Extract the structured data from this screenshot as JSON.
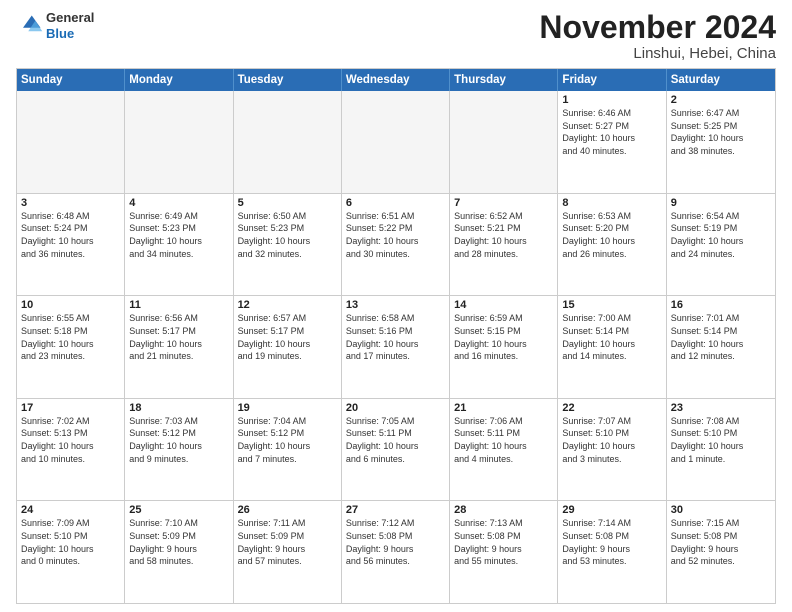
{
  "header": {
    "logo": {
      "line1": "General",
      "line2": "Blue"
    },
    "title": "November 2024",
    "location": "Linshui, Hebei, China"
  },
  "weekdays": [
    "Sunday",
    "Monday",
    "Tuesday",
    "Wednesday",
    "Thursday",
    "Friday",
    "Saturday"
  ],
  "rows": [
    [
      {
        "day": "",
        "info": "",
        "empty": true
      },
      {
        "day": "",
        "info": "",
        "empty": true
      },
      {
        "day": "",
        "info": "",
        "empty": true
      },
      {
        "day": "",
        "info": "",
        "empty": true
      },
      {
        "day": "",
        "info": "",
        "empty": true
      },
      {
        "day": "1",
        "info": "Sunrise: 6:46 AM\nSunset: 5:27 PM\nDaylight: 10 hours\nand 40 minutes.",
        "empty": false
      },
      {
        "day": "2",
        "info": "Sunrise: 6:47 AM\nSunset: 5:25 PM\nDaylight: 10 hours\nand 38 minutes.",
        "empty": false
      }
    ],
    [
      {
        "day": "3",
        "info": "Sunrise: 6:48 AM\nSunset: 5:24 PM\nDaylight: 10 hours\nand 36 minutes.",
        "empty": false
      },
      {
        "day": "4",
        "info": "Sunrise: 6:49 AM\nSunset: 5:23 PM\nDaylight: 10 hours\nand 34 minutes.",
        "empty": false
      },
      {
        "day": "5",
        "info": "Sunrise: 6:50 AM\nSunset: 5:23 PM\nDaylight: 10 hours\nand 32 minutes.",
        "empty": false
      },
      {
        "day": "6",
        "info": "Sunrise: 6:51 AM\nSunset: 5:22 PM\nDaylight: 10 hours\nand 30 minutes.",
        "empty": false
      },
      {
        "day": "7",
        "info": "Sunrise: 6:52 AM\nSunset: 5:21 PM\nDaylight: 10 hours\nand 28 minutes.",
        "empty": false
      },
      {
        "day": "8",
        "info": "Sunrise: 6:53 AM\nSunset: 5:20 PM\nDaylight: 10 hours\nand 26 minutes.",
        "empty": false
      },
      {
        "day": "9",
        "info": "Sunrise: 6:54 AM\nSunset: 5:19 PM\nDaylight: 10 hours\nand 24 minutes.",
        "empty": false
      }
    ],
    [
      {
        "day": "10",
        "info": "Sunrise: 6:55 AM\nSunset: 5:18 PM\nDaylight: 10 hours\nand 23 minutes.",
        "empty": false
      },
      {
        "day": "11",
        "info": "Sunrise: 6:56 AM\nSunset: 5:17 PM\nDaylight: 10 hours\nand 21 minutes.",
        "empty": false
      },
      {
        "day": "12",
        "info": "Sunrise: 6:57 AM\nSunset: 5:17 PM\nDaylight: 10 hours\nand 19 minutes.",
        "empty": false
      },
      {
        "day": "13",
        "info": "Sunrise: 6:58 AM\nSunset: 5:16 PM\nDaylight: 10 hours\nand 17 minutes.",
        "empty": false
      },
      {
        "day": "14",
        "info": "Sunrise: 6:59 AM\nSunset: 5:15 PM\nDaylight: 10 hours\nand 16 minutes.",
        "empty": false
      },
      {
        "day": "15",
        "info": "Sunrise: 7:00 AM\nSunset: 5:14 PM\nDaylight: 10 hours\nand 14 minutes.",
        "empty": false
      },
      {
        "day": "16",
        "info": "Sunrise: 7:01 AM\nSunset: 5:14 PM\nDaylight: 10 hours\nand 12 minutes.",
        "empty": false
      }
    ],
    [
      {
        "day": "17",
        "info": "Sunrise: 7:02 AM\nSunset: 5:13 PM\nDaylight: 10 hours\nand 10 minutes.",
        "empty": false
      },
      {
        "day": "18",
        "info": "Sunrise: 7:03 AM\nSunset: 5:12 PM\nDaylight: 10 hours\nand 9 minutes.",
        "empty": false
      },
      {
        "day": "19",
        "info": "Sunrise: 7:04 AM\nSunset: 5:12 PM\nDaylight: 10 hours\nand 7 minutes.",
        "empty": false
      },
      {
        "day": "20",
        "info": "Sunrise: 7:05 AM\nSunset: 5:11 PM\nDaylight: 10 hours\nand 6 minutes.",
        "empty": false
      },
      {
        "day": "21",
        "info": "Sunrise: 7:06 AM\nSunset: 5:11 PM\nDaylight: 10 hours\nand 4 minutes.",
        "empty": false
      },
      {
        "day": "22",
        "info": "Sunrise: 7:07 AM\nSunset: 5:10 PM\nDaylight: 10 hours\nand 3 minutes.",
        "empty": false
      },
      {
        "day": "23",
        "info": "Sunrise: 7:08 AM\nSunset: 5:10 PM\nDaylight: 10 hours\nand 1 minute.",
        "empty": false
      }
    ],
    [
      {
        "day": "24",
        "info": "Sunrise: 7:09 AM\nSunset: 5:10 PM\nDaylight: 10 hours\nand 0 minutes.",
        "empty": false
      },
      {
        "day": "25",
        "info": "Sunrise: 7:10 AM\nSunset: 5:09 PM\nDaylight: 9 hours\nand 58 minutes.",
        "empty": false
      },
      {
        "day": "26",
        "info": "Sunrise: 7:11 AM\nSunset: 5:09 PM\nDaylight: 9 hours\nand 57 minutes.",
        "empty": false
      },
      {
        "day": "27",
        "info": "Sunrise: 7:12 AM\nSunset: 5:08 PM\nDaylight: 9 hours\nand 56 minutes.",
        "empty": false
      },
      {
        "day": "28",
        "info": "Sunrise: 7:13 AM\nSunset: 5:08 PM\nDaylight: 9 hours\nand 55 minutes.",
        "empty": false
      },
      {
        "day": "29",
        "info": "Sunrise: 7:14 AM\nSunset: 5:08 PM\nDaylight: 9 hours\nand 53 minutes.",
        "empty": false
      },
      {
        "day": "30",
        "info": "Sunrise: 7:15 AM\nSunset: 5:08 PM\nDaylight: 9 hours\nand 52 minutes.",
        "empty": false
      }
    ]
  ]
}
